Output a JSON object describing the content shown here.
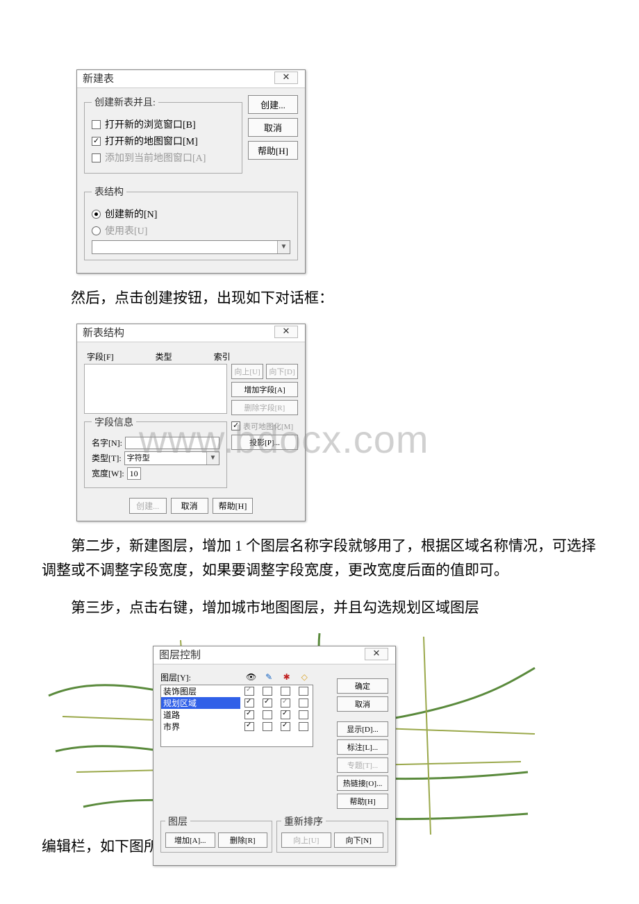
{
  "watermark": "www.bdocx.com",
  "dialog1": {
    "title": "新建表",
    "close": "✕",
    "group1_legend": "创建新表并且:",
    "cb_browser": "打开新的浏览窗口[B]",
    "cb_map": "打开新的地图窗口[M]",
    "cb_add": "添加到当前地图窗口[A]",
    "btn_create": "创建...",
    "btn_cancel": "取消",
    "btn_help": "帮助[H]",
    "group2_legend": "表结构",
    "rb_new": "创建新的[N]",
    "rb_use": "使用表[U]"
  },
  "text_after_dlg1": "然后，点击创建按钮，出现如下对话框：",
  "dialog2": {
    "title": "新表结构",
    "close": "✕",
    "col_field": "字段[F]",
    "col_type": "类型",
    "col_index": "索引",
    "btn_up": "向上[U]",
    "btn_down": "向下[D]",
    "btn_addf": "增加字段[A]",
    "btn_delf": "删除字段[R]",
    "fi_legend": "字段信息",
    "lbl_name": "名字[N]:",
    "lbl_type": "类型[T]:",
    "type_value": "字符型",
    "lbl_width": "宽度[W]:",
    "width_value": "10",
    "cb_mappable": "表可地图化[M]",
    "btn_proj": "投影[P]...",
    "btn_create": "创建...",
    "btn_cancel": "取消",
    "btn_help": "帮助[H]"
  },
  "para_step2": "第二步，新建图层，增加 1 个图层名称字段就够用了，根据区域名称情况，可选择调整或不调整字段宽度，如果要调整字段宽度，更改宽度后面的值即可。",
  "para_step3": "第三步，点击右键，增加城市地图图层，并且勾选规划区域图层",
  "dialog3": {
    "title": "图层控制",
    "close": "✕",
    "lbl_layer": "图层[Y]:",
    "icon_eye": "👁",
    "icon_pencil": "✎",
    "icon_star": "✱",
    "icon_tag": "◇",
    "layers": [
      {
        "name": "装饰图层",
        "c": [
          "g",
          "u",
          "u",
          "u"
        ]
      },
      {
        "name": "规划区域",
        "c": [
          "c",
          "c",
          "g",
          "u"
        ],
        "selected": true
      },
      {
        "name": "道路",
        "c": [
          "c",
          "u",
          "c",
          "u"
        ]
      },
      {
        "name": "市界",
        "c": [
          "c",
          "u",
          "c",
          "u"
        ]
      }
    ],
    "btn_ok": "确定",
    "btn_cancel": "取消",
    "btn_display": "显示[D]...",
    "btn_label": "标注[L]...",
    "btn_theme": "专题[T]...",
    "btn_hotlink": "热链接[O]...",
    "btn_help": "帮助[H]",
    "grp_layer": "图层",
    "btn_add": "增加[A]...",
    "btn_remove": "删除[R]",
    "grp_reorder": "重新排序",
    "btn_up": "向上[U]",
    "btn_down": "向下[N]"
  },
  "left_text": "编辑栏，如下图所示："
}
